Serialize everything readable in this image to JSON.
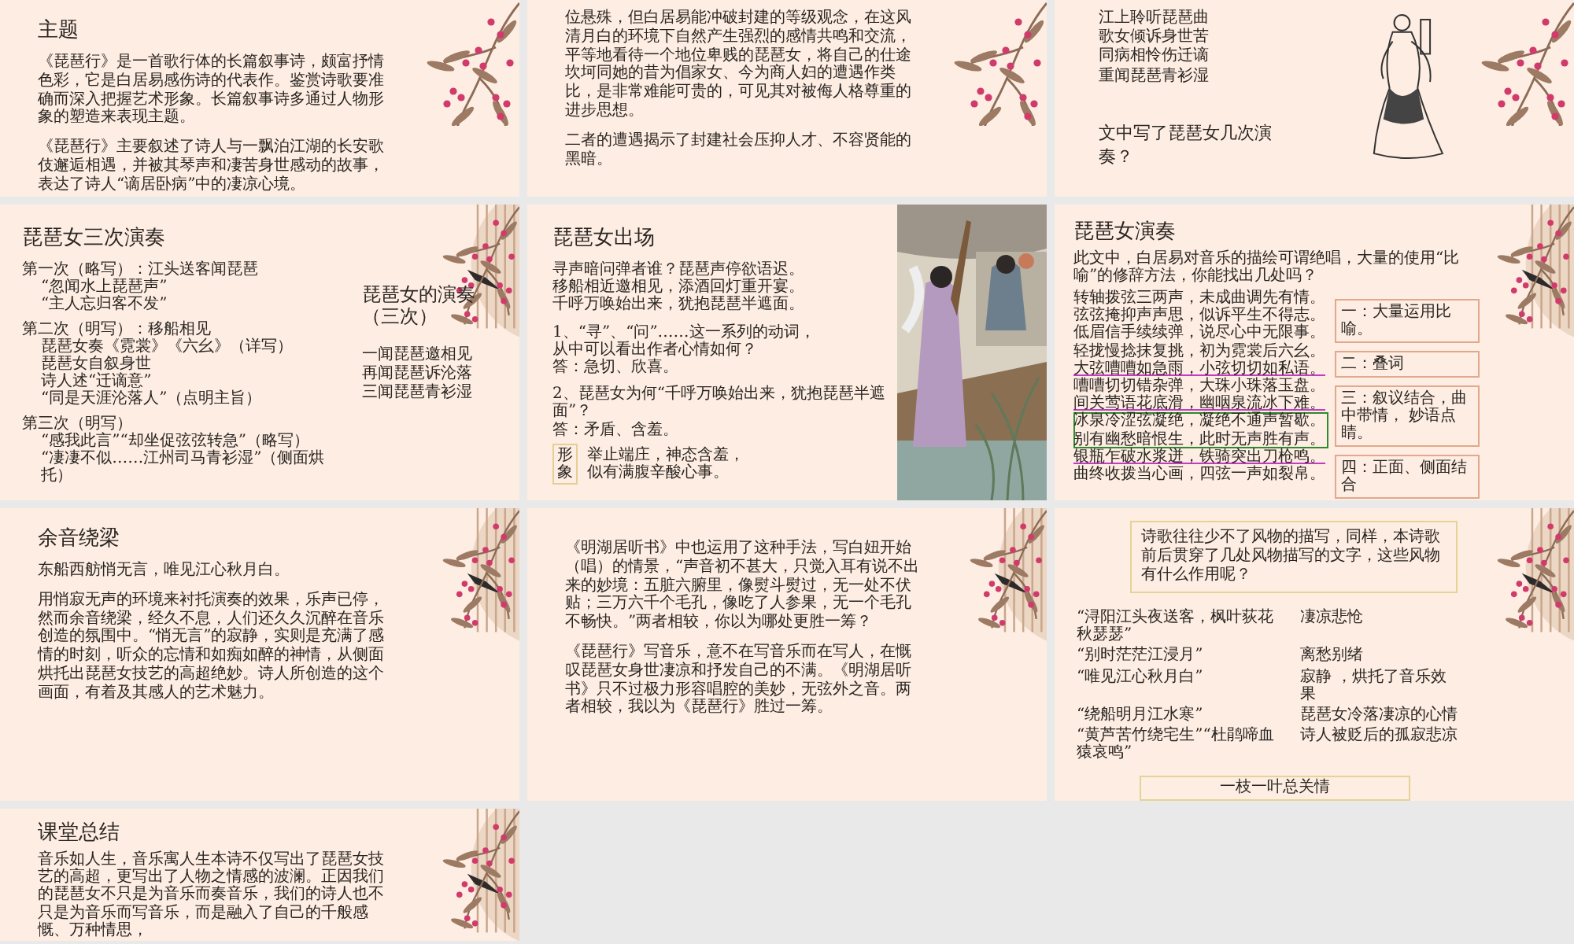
{
  "slides": [
    {
      "kind": "text",
      "title": "主题",
      "paragraphs": [
        "《琵琶行》是一首歌行体的长篇叙事诗，颇富抒情色彩，它是白居易感伤诗的代表作。鉴赏诗歌要准确而深入把握艺术形象。长篇叙事诗多通过人物形象的塑造来表现主题。",
        "《琵琶行》主要叙述了诗人与一飘泊江湖的长安歌伎邂逅相遇，并被其琴声和凄苦身世感动的故事，表达了诗人“谪居卧病”中的凄凉心境。"
      ]
    },
    {
      "kind": "text",
      "paragraphs": [
        "位悬殊，但白居易能冲破封建的等级观念，在这风清月白的环境下自然产生强烈的感情共鸣和交流，平等地看待一个地位卑贱的琵琶女，将自己的仕途坎坷同她的昔为倡家女、今为商人妇的遭遇作类比，是非常难能可贵的，可见其对被侮人格尊重的进步思想。",
        "二者的遭遇揭示了封建社会压抑人才、不容贤能的黑暗。"
      ]
    },
    {
      "kind": "poem_question",
      "lines": [
        "江上聆听琵琶曲",
        "歌女倾诉身世苦",
        "同病相怜伤迁谪",
        "重闻琵琶青衫湿"
      ],
      "question": "文中写了琵琶女几次演奏？"
    },
    {
      "kind": "performances",
      "title": "琵琶女三次演奏",
      "groups": [
        {
          "heading": "第一次（略写）：江头送客闻琵琶",
          "lines": [
            "“忽闻水上琵琶声”",
            "“主人忘归客不发”"
          ]
        },
        {
          "heading": "第二次（明写）：移船相见",
          "lines": [
            "琵琶女奏《霓裳》《六幺》（详写）",
            "琵琶女自叙身世",
            "诗人述“迁谪意”",
            "“同是天涯沦落人”（点明主旨）"
          ]
        },
        {
          "heading": "第三次（明写）",
          "lines": [
            "“感我此言”“却坐促弦弦转急”（略写）",
            "“凄凄不似……江州司马青衫湿”（侧面烘托）"
          ]
        }
      ],
      "summary_title": "琵琶女的演奏（三次）",
      "summary": [
        "一闻琵琶邀相见",
        "再闻琵琶诉沦落",
        "三闻琵琶青衫湿"
      ]
    },
    {
      "kind": "entrance",
      "media": {
        "kind": "picture"
      },
      "title": "琵琶女出场",
      "poem": [
        "寻声暗问弹者谁？琵琶声停欲语迟。",
        "移船相近邀相见，添酒回灯重开宴。",
        "千呼万唤始出来，犹抱琵琶半遮面。"
      ],
      "questions": [
        {
          "question": [
            "1、“寻”、“问”……这一系列的动词，",
            "从中可以看出作者心情如何？"
          ],
          "answer": "答：急切、欣喜。"
        },
        {
          "question": [
            "2、琵琶女为何“千呼万唤始出来，犹抱琵琶半遮面”？"
          ],
          "answer": "答：矛盾、含羞。"
        }
      ],
      "image_label": "形象",
      "image_lines": [
        "举止端庄，神态含羞，",
        "似有满腹辛酸心事。"
      ]
    },
    {
      "kind": "metaphors",
      "title": "琵琶女演奏",
      "intro": "此文中，白居易对音乐的描绘可谓绝唱，大量的使用“比喻”的修辞方法，你能找出几处吗？",
      "lines": [
        {
          "text": "转轴拨弦三两声，未成曲调先有情。",
          "underlined": false,
          "boxed": false
        },
        {
          "text": "弦弦掩抑声声思，似诉平生不得志。",
          "underlined": false,
          "boxed": false
        },
        {
          "text": "低眉信手续续弹，说尽心中无限事。",
          "underlined": false,
          "boxed": false
        },
        {
          "text": "轻拢慢捻抹复挑，初为霓裳后六幺。",
          "underlined": false,
          "boxed": false
        },
        {
          "text": "大弦嘈嘈如急雨，小弦切切如私语。",
          "underlined": true,
          "boxed": false
        },
        {
          "text": "嘈嘈切切错杂弹，大珠小珠落玉盘。",
          "underlined": false,
          "boxed": false
        },
        {
          "text": "间关莺语花底滑，幽咽泉流冰下难。",
          "underlined": true,
          "boxed": false
        },
        {
          "text": "冰泉冷涩弦凝绝，凝绝不通声暂歇。",
          "underlined": false,
          "boxed": true
        },
        {
          "text": "别有幽愁暗恨生，此时无声胜有声。",
          "underlined": false,
          "boxed": true
        },
        {
          "text": "银瓶乍破水浆迸，铁骑突出刀枪鸣。",
          "underlined": true,
          "boxed": false
        },
        {
          "text": "曲终收拨当心画，四弦一声如裂帛。",
          "underlined": false,
          "boxed": false
        }
      ],
      "notes": [
        "一：大量运用比喻。",
        "二：叠词",
        "三：叙议结合，曲中带情， 妙语点睛。",
        "四：正面、侧面结合"
      ]
    },
    {
      "kind": "text",
      "title": "余音绕梁",
      "paragraphs": [
        "东船西舫悄无言，唯见江心秋月白。",
        "用悄寂无声的环境来衬托演奏的效果，乐声已停，然而余音绕梁，经久不息，人们还久久沉醉在音乐创造的氛围中。“悄无言”的寂静，实则是充满了感情的时刻，听众的忘情和如痴如醉的神情，从侧面烘托出琵琶女技艺的高超绝妙。诗人所创造的这个画面，有着及其感人的艺术魅力。"
      ]
    },
    {
      "kind": "text",
      "paragraphs": [
        "《明湖居听书》中也运用了这种手法，写白妞开始（唱）的情景，“声音初不甚大，只觉入耳有说不出来的妙境：五脏六腑里，像熨斗熨过，无一处不伏贴；三万六千个毛孔，像吃了人参果，无一个毛孔不畅快。”两者相较，你以为哪处更胜一筹？",
        "《琵琶行》写音乐，意不在写音乐而在写人，在慨叹琵琶女身世凄凉和抒发自己的不满。《明湖居听书》只不过极力形容唱腔的美妙，无弦外之音。两者相较，我以为《琵琶行》胜过一筹。"
      ]
    },
    {
      "kind": "scenery",
      "question": "诗歌往往少不了风物的描写，同样，本诗歌前后贯穿了几处风物描写的文字，这些风物有什么作用呢？",
      "rows": [
        {
          "quote": "“浔阳江头夜送客，枫叶荻花秋瑟瑟”",
          "meaning": "凄凉悲怆"
        },
        {
          "quote": "“别时茫茫江浸月”",
          "meaning": "离愁别绪"
        },
        {
          "quote": "“唯见江心秋月白”",
          "meaning": "寂静 ，烘托了音乐效果"
        },
        {
          "quote": "“绕船明月江水寒”",
          "meaning": "琵琶女冷落凄凉的心情"
        },
        {
          "quote": "“黄芦苦竹绕宅生”“杜鹃啼血猿哀鸣”",
          "meaning": "诗人被贬后的孤寂悲凉"
        }
      ],
      "footer": "一枝一叶总关情"
    },
    {
      "kind": "text",
      "title": "课堂总结",
      "paragraphs": [
        "音乐如人生，音乐寓人生本诗不仅写出了琵琶女技艺的高超，更写出了人物之情感的波澜。正因我们的琵琶女不只是为音乐而奏音乐，我们的诗人也不只是为音乐而写音乐，而是融入了自己的千般感慨、万种情思，"
      ]
    }
  ]
}
